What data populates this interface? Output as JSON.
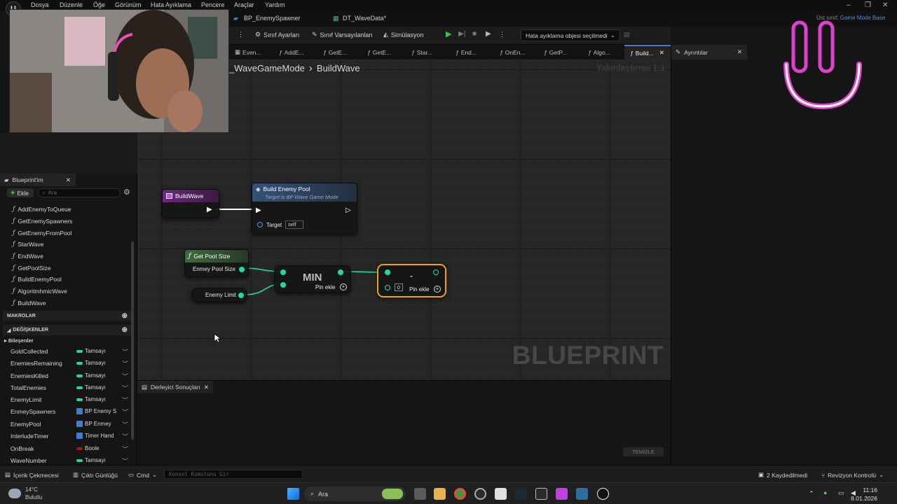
{
  "menu": {
    "logo": "U",
    "items": [
      "Dosya",
      "Düzenle",
      "Öğe",
      "Görünüm",
      "Hata Ayıklama",
      "Pencere",
      "Araçlar",
      "Yardım"
    ]
  },
  "document_tabs": [
    {
      "label": "BP_EnemySpawner"
    },
    {
      "label": "DT_WaveData*"
    }
  ],
  "parent_class": {
    "prefix": "Üst sınıf:",
    "value": "Game Mode Base"
  },
  "toolbar": {
    "class_settings": "Sınıf Ayarları",
    "class_defaults": "Sınıf Varsayılanları",
    "simulation": "Simülasyon",
    "debug_object": "Hata ayıklama objesi seçilmedi"
  },
  "graph_tabs": [
    "Even...",
    "AddE...",
    "GetE...",
    "GetE...",
    "Star...",
    "End...",
    "OnEn...",
    "GetP...",
    "Algo...",
    "Build..."
  ],
  "details": {
    "tab_label": "Ayrıntılar"
  },
  "breadcrumb": {
    "parent": "_WaveGameMode",
    "current": "BuildWave"
  },
  "zoom_label": "Yakınlaştırma 1:1",
  "watermark": "BLUEPRINT",
  "nodes": {
    "entry": {
      "title": "BuildWave"
    },
    "build_pool": {
      "title": "Build Enemy Pool",
      "subtitle": "Target is BP Wave Game Mode",
      "target_label": "Target",
      "target_value": "self"
    },
    "get_pool_size": {
      "title": "Get Pool Size",
      "output": "Enmey Pool Size"
    },
    "enemy_limit": {
      "label": "Enemy Limit"
    },
    "min": {
      "title": "MIN",
      "add_pin": "Pin ekle"
    },
    "subtract": {
      "title": "-",
      "input_value": "0",
      "add_pin": "Pin ekle"
    }
  },
  "compiler": {
    "tab_label": "Derleyici Sonuçları",
    "clear_label": "TEMİZLE"
  },
  "left_panel": {
    "tab_label": "Blueprint'im",
    "add_label": "Ekle",
    "search_placeholder": "Ara",
    "functions": [
      "AddEnemyToQueue",
      "GetEnemySpawners",
      "GetEnemyFromPool",
      "StarWave",
      "EndWave",
      "GetPoolSize",
      "BuildEnemyPool",
      "AlgoritmhmicWave",
      "BuildWave"
    ],
    "macros_label": "MAKROLAR",
    "variables_label": "DEĞİŞKENLER",
    "components_label": "Bileşenler",
    "variables": [
      {
        "name": "GoldCollected",
        "type": "Tamsayı",
        "color": "#28d7a0"
      },
      {
        "name": "EnemiesRemaining",
        "type": "Tamsayı",
        "color": "#28d7a0"
      },
      {
        "name": "EnemiesKilled",
        "type": "Tamsayı",
        "color": "#28d7a0"
      },
      {
        "name": "TotalEnemies",
        "type": "Tamsayı",
        "color": "#28d7a0"
      },
      {
        "name": "EnemyLimit",
        "type": "Tamsayı",
        "color": "#28d7a0"
      },
      {
        "name": "EnmeySpawners",
        "type": "BP Enemy S",
        "color": "#3c7dd8"
      },
      {
        "name": "EnemyPool",
        "type": "BP Enmey",
        "color": "#3c7dd8"
      },
      {
        "name": "InterludeTimer",
        "type": "Timer Hand",
        "color": "#3c7dd8"
      },
      {
        "name": "OnBreak",
        "type": "Boole",
        "color": "#9c1b1b"
      },
      {
        "name": "WaveNumber",
        "type": "Tamsayı",
        "color": "#28d7a0"
      }
    ]
  },
  "statusbar": {
    "content_drawer": "İçerik Çekmecesi",
    "output_log": "Çıktı Günlüğü",
    "cmd": "Cmd",
    "console_placeholder": "Konsol Komutunu Gir",
    "unsaved": "2 Kaydedilmedi",
    "revision": "Revizyon Kontrolü"
  },
  "taskbar": {
    "temperature": "14°C",
    "weather": "Bulutlu",
    "search": "Ara",
    "time": "11:16",
    "date": "8.01.2026"
  },
  "colors": {
    "exec_wire": "#ffffff",
    "int_wire": "#1fdc9c",
    "function_head": "#3b5e3b",
    "event_head": "#5a1f6a",
    "selected_border": "#f0a30a",
    "accent_logo": "#e040d0"
  },
  "icons": [
    "unreal-logo-icon",
    "settings-icon",
    "play-icon",
    "search-icon",
    "function-icon",
    "plus-icon",
    "eye-icon",
    "windows-start-icon",
    "chrome-icon",
    "steam-icon",
    "epic-icon"
  ]
}
